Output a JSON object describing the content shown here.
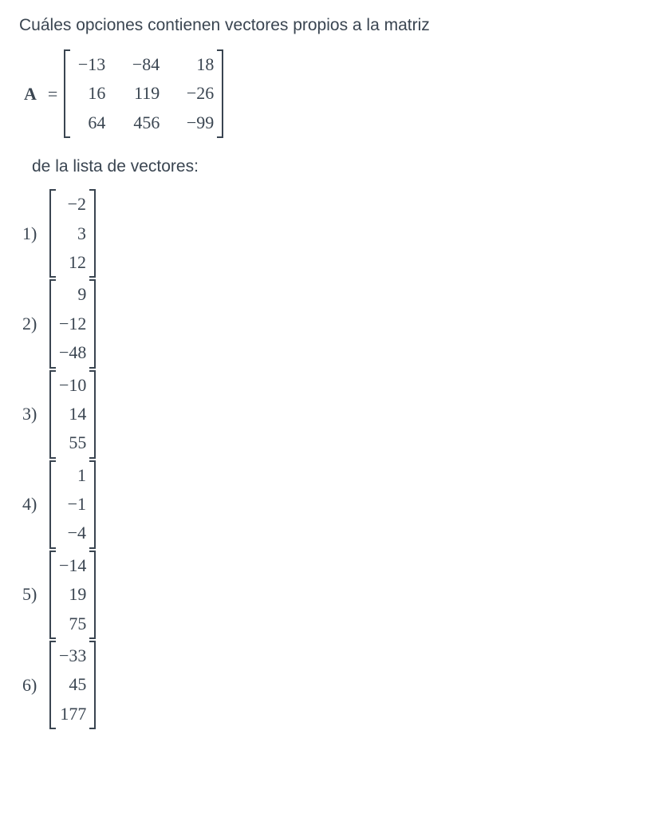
{
  "question": "Cuáles opciones   contienen vectores propios a la matriz",
  "lhs": "A",
  "eq": "=",
  "matrix_A": [
    [
      "−13",
      "−84",
      "18"
    ],
    [
      "16",
      "119",
      "−26"
    ],
    [
      "64",
      "456",
      "−99"
    ]
  ],
  "list_intro": "de la lista de vectores:",
  "options": [
    {
      "label": "1)",
      "vec": [
        "−2",
        "3",
        "12"
      ]
    },
    {
      "label": "2)",
      "vec": [
        "9",
        "−12",
        "−48"
      ]
    },
    {
      "label": "3)",
      "vec": [
        "−10",
        "14",
        "55"
      ]
    },
    {
      "label": "4)",
      "vec": [
        "1",
        "−1",
        "−4"
      ]
    },
    {
      "label": "5)",
      "vec": [
        "−14",
        "19",
        "75"
      ]
    },
    {
      "label": "6)",
      "vec": [
        "−33",
        "45",
        "177"
      ]
    }
  ]
}
